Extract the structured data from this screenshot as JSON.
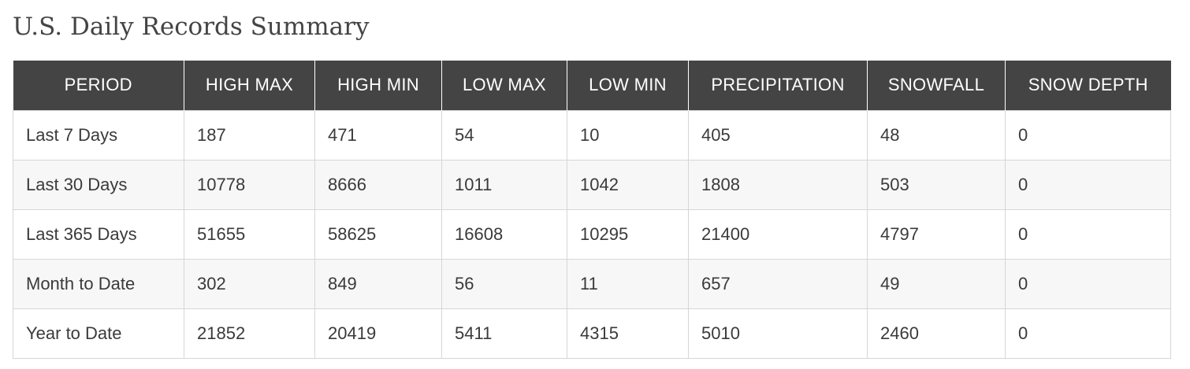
{
  "title": "U.S. Daily Records Summary",
  "table": {
    "headers": [
      "PERIOD",
      "HIGH MAX",
      "HIGH MIN",
      "LOW MAX",
      "LOW MIN",
      "PRECIPITATION",
      "SNOWFALL",
      "SNOW DEPTH"
    ],
    "rows": [
      [
        "Last 7 Days",
        "187",
        "471",
        "54",
        "10",
        "405",
        "48",
        "0"
      ],
      [
        "Last 30 Days",
        "10778",
        "8666",
        "1011",
        "1042",
        "1808",
        "503",
        "0"
      ],
      [
        "Last 365 Days",
        "51655",
        "58625",
        "16608",
        "10295",
        "21400",
        "4797",
        "0"
      ],
      [
        "Month to Date",
        "302",
        "849",
        "56",
        "11",
        "657",
        "49",
        "0"
      ],
      [
        "Year to Date",
        "21852",
        "20419",
        "5411",
        "4315",
        "5010",
        "2460",
        "0"
      ]
    ]
  },
  "colors": {
    "header_background": "#444444",
    "header_text": "#ffffff",
    "stripe_background": "#f7f7f7",
    "border": "#d6d6d6"
  }
}
